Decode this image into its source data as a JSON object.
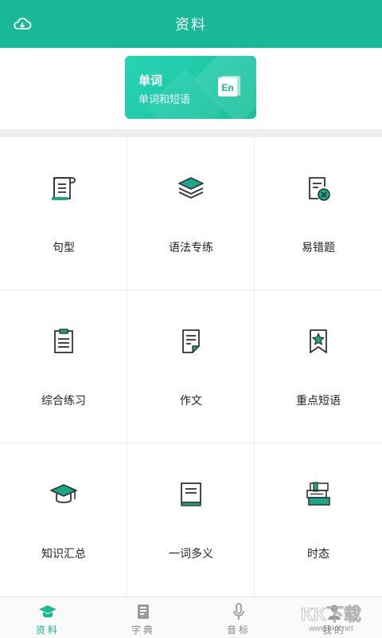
{
  "header": {
    "title": "资料",
    "left_icon": "cloud-download-icon"
  },
  "banner": {
    "title": "单词",
    "subtitle": "单词和短语",
    "badge": "En"
  },
  "grid": [
    {
      "label": "句型",
      "icon": "scroll-icon"
    },
    {
      "label": "语法专练",
      "icon": "layers-icon"
    },
    {
      "label": "易错题",
      "icon": "error-doc-icon"
    },
    {
      "label": "综合练习",
      "icon": "clipboard-icon"
    },
    {
      "label": "作文",
      "icon": "document-icon"
    },
    {
      "label": "重点短语",
      "icon": "bookmark-star-icon"
    },
    {
      "label": "知识汇总",
      "icon": "graduation-cap-icon"
    },
    {
      "label": "一词多义",
      "icon": "book-icon"
    },
    {
      "label": "时态",
      "icon": "books-stack-icon"
    }
  ],
  "tabbar": {
    "tabs": [
      {
        "label": "资料",
        "icon": "graduation-cap-icon",
        "active": true
      },
      {
        "label": "字典",
        "icon": "dictionary-icon",
        "active": false
      },
      {
        "label": "音标",
        "icon": "microphone-icon",
        "active": false
      },
      {
        "label": "我的",
        "icon": "person-icon",
        "active": false
      }
    ]
  },
  "watermark": {
    "text": "KK下载",
    "domain": "www.kkx.net"
  },
  "colors": {
    "accent": "#19b896",
    "icon_fill": "#1aa889",
    "icon_stroke": "#333333"
  }
}
